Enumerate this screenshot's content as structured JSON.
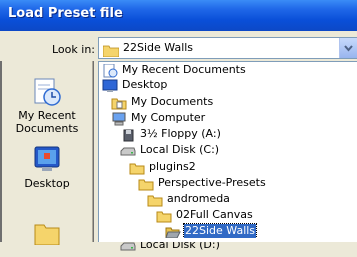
{
  "window": {
    "title": "Load Preset file"
  },
  "look_in": {
    "label": "Look in:",
    "value": "22Side Walls"
  },
  "places": [
    {
      "label": "My Recent Documents",
      "icon": "recent-documents-icon"
    },
    {
      "label": "Desktop",
      "icon": "desktop-icon"
    }
  ],
  "locations": [
    {
      "label": "My Recent Documents",
      "icon": "recent-docs-icon"
    },
    {
      "label": "Desktop",
      "icon": "desktop-icon"
    },
    {
      "label": "My Documents",
      "icon": "my-documents-icon"
    },
    {
      "label": "My Computer",
      "icon": "my-computer-icon"
    },
    {
      "label": "3½ Floppy (A:)",
      "icon": "floppy-icon"
    },
    {
      "label": "Local Disk (C:)",
      "icon": "hard-disk-icon"
    },
    {
      "label": "plugins2",
      "icon": "folder-icon"
    },
    {
      "label": "Perspective-Presets",
      "icon": "folder-icon"
    },
    {
      "label": "andromeda",
      "icon": "folder-icon"
    },
    {
      "label": "02Full Canvas",
      "icon": "folder-icon"
    },
    {
      "label": "22Side Walls",
      "icon": "open-folder-icon",
      "selected": true
    },
    {
      "label": "Local Disk (D:)",
      "icon": "hard-disk-icon"
    }
  ]
}
